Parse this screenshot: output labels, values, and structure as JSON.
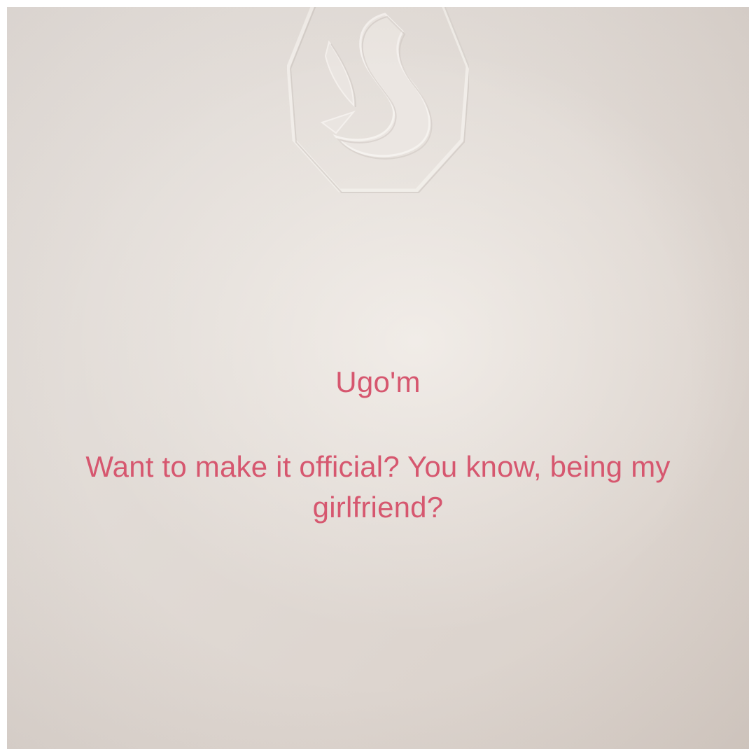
{
  "card": {
    "greeting": "Ugo'm",
    "message": "Want to make it official? You know, being my girlfriend?",
    "emboss_icon": "swan-logo-emboss",
    "ink_color": "#d6576f",
    "paper_color": "#e2dcd7"
  }
}
